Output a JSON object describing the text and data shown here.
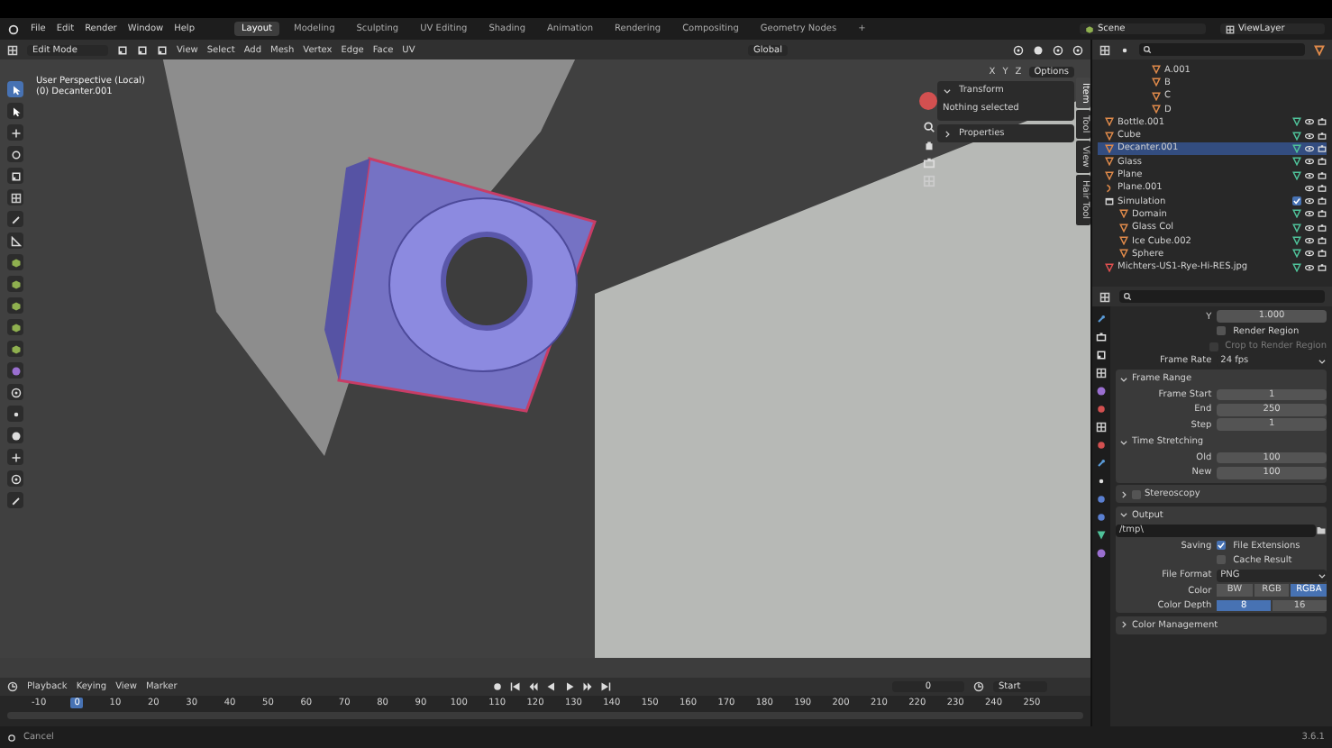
{
  "menu": [
    "File",
    "Edit",
    "Render",
    "Window",
    "Help"
  ],
  "workspaces": [
    {
      "label": "Layout",
      "selected": true
    },
    {
      "label": "Modeling",
      "selected": false
    },
    {
      "label": "Sculpting",
      "selected": false
    },
    {
      "label": "UV Editing",
      "selected": false
    },
    {
      "label": "Shading",
      "selected": false
    },
    {
      "label": "Animation",
      "selected": false
    },
    {
      "label": "Rendering",
      "selected": false
    },
    {
      "label": "Compositing",
      "selected": false
    },
    {
      "label": "Geometry Nodes",
      "selected": false
    }
  ],
  "add_workspace": "+",
  "scene": "Scene",
  "view_layer": "ViewLayer",
  "viewport_header": {
    "mode": "Edit Mode",
    "menus": [
      "View",
      "Select",
      "Add",
      "Mesh",
      "Vertex",
      "Edge",
      "Face",
      "UV"
    ],
    "orientation": "Global"
  },
  "viewport": {
    "axes": [
      "X",
      "Y",
      "Z"
    ],
    "options": "Options",
    "overlay_lines": [
      "User Perspective (Local)",
      "(0) Decanter.001"
    ],
    "sidebar_tabs": [
      {
        "label": "Item",
        "selected": true
      },
      {
        "label": "Tool",
        "selected": false
      },
      {
        "label": "View",
        "selected": false
      },
      {
        "label": "Hair Tool",
        "selected": false
      }
    ],
    "panels": [
      {
        "title": "Transform",
        "expanded": true,
        "text": "Nothing selected"
      },
      {
        "title": "Properties",
        "expanded": false
      }
    ]
  },
  "outliner": {
    "nested_rows": [
      {
        "name": "A.001"
      },
      {
        "name": "B"
      },
      {
        "name": "C"
      },
      {
        "name": "D"
      }
    ],
    "rows": [
      {
        "name": "Bottle.001",
        "kind": "mesh",
        "selected": false
      },
      {
        "name": "Cube",
        "kind": "mesh",
        "selected": false
      },
      {
        "name": "Decanter.001",
        "kind": "mesh",
        "selected": true
      },
      {
        "name": "Glass",
        "kind": "mesh",
        "selected": false
      },
      {
        "name": "Plane",
        "kind": "mesh",
        "selected": false
      },
      {
        "name": "Plane.001",
        "kind": "curve",
        "selected": false
      },
      {
        "name": "Simulation",
        "kind": "collection",
        "selected": false,
        "checked": true,
        "children": [
          {
            "name": "Domain",
            "kind": "mesh",
            "selected": false
          },
          {
            "name": "Glass Col",
            "kind": "mesh",
            "selected": false
          },
          {
            "name": "Ice Cube.002",
            "kind": "mesh",
            "selected": false
          },
          {
            "name": "Sphere",
            "kind": "mesh",
            "selected": false
          }
        ]
      },
      {
        "name": "Michters-US1-Rye-Hi-RES.jpg",
        "kind": "image",
        "selected": false
      }
    ]
  },
  "properties": {
    "rows": [
      {
        "kind": "field",
        "label": "Y",
        "value": "1.000"
      },
      {
        "kind": "checkbox",
        "text": "Render Region",
        "checked": false,
        "disabled": false
      },
      {
        "kind": "checkbox",
        "text": "Crop to Render Region",
        "checked": false,
        "disabled": true
      },
      {
        "kind": "dropdown",
        "label": "Frame Rate",
        "value": "24 fps"
      },
      {
        "kind": "section",
        "label": "Frame Range",
        "expanded": true,
        "rows": [
          {
            "kind": "field",
            "label": "Frame Start",
            "value": "1"
          },
          {
            "kind": "field",
            "label": "End",
            "value": "250"
          },
          {
            "kind": "field",
            "label": "Step",
            "value": "1"
          },
          {
            "kind": "section",
            "label": "Time Stretching",
            "expanded": true,
            "rows": [
              {
                "kind": "field",
                "label": "Old",
                "value": "100"
              },
              {
                "kind": "field",
                "label": "New",
                "value": "100"
              }
            ]
          }
        ]
      },
      {
        "kind": "section",
        "label": "Stereoscopy",
        "expanded": false,
        "checked": false
      },
      {
        "kind": "section",
        "label": "Output",
        "expanded": true,
        "rows": [
          {
            "kind": "path",
            "value": "/tmp\\"
          },
          {
            "kind": "checkbox",
            "label": "Saving",
            "text": "File Extensions",
            "checked": true,
            "disabled": false
          },
          {
            "kind": "checkbox",
            "text": "Cache Result",
            "checked": false,
            "disabled": false
          },
          {
            "kind": "dropdown",
            "label": "File Format",
            "value": "PNG"
          },
          {
            "kind": "segmented",
            "label": "Color",
            "options": [
              {
                "label": "BW",
                "selected": false
              },
              {
                "label": "RGB",
                "selected": false
              },
              {
                "label": "RGBA",
                "selected": true
              }
            ]
          },
          {
            "kind": "segmented",
            "label": "Color Depth",
            "options": [
              {
                "label": "8",
                "selected": true
              },
              {
                "label": "16",
                "selected": false
              }
            ]
          }
        ]
      },
      {
        "kind": "section",
        "label": "Color Management",
        "expanded": false
      }
    ]
  },
  "timeline": {
    "menus": [
      "Playback",
      "Keying",
      "View",
      "Marker"
    ],
    "current_frame": "0",
    "start_label": "Start",
    "ticks": [
      {
        "label": "-10",
        "selected": false
      },
      {
        "label": "0",
        "selected": true
      },
      {
        "label": "10",
        "selected": false
      },
      {
        "label": "20",
        "selected": false
      },
      {
        "label": "30",
        "selected": false
      },
      {
        "label": "40",
        "selected": false
      },
      {
        "label": "50",
        "selected": false
      },
      {
        "label": "60",
        "selected": false
      },
      {
        "label": "70",
        "selected": false
      },
      {
        "label": "80",
        "selected": false
      },
      {
        "label": "90",
        "selected": false
      },
      {
        "label": "100",
        "selected": false
      },
      {
        "label": "110",
        "selected": false
      },
      {
        "label": "120",
        "selected": false
      },
      {
        "label": "130",
        "selected": false
      },
      {
        "label": "140",
        "selected": false
      },
      {
        "label": "150",
        "selected": false
      },
      {
        "label": "160",
        "selected": false
      },
      {
        "label": "170",
        "selected": false
      },
      {
        "label": "180",
        "selected": false
      },
      {
        "label": "190",
        "selected": false
      },
      {
        "label": "200",
        "selected": false
      },
      {
        "label": "210",
        "selected": false
      },
      {
        "label": "220",
        "selected": false
      },
      {
        "label": "230",
        "selected": false
      },
      {
        "label": "240",
        "selected": false
      },
      {
        "label": "250",
        "selected": false
      }
    ]
  },
  "status_bar": {
    "hint": "Cancel",
    "version": "3.6.1"
  }
}
